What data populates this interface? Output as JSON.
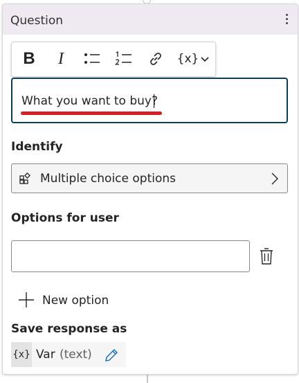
{
  "card": {
    "title": "Question",
    "more_icon": "more-vertical-icon"
  },
  "toolbar": {
    "bold_label": "B",
    "italic_label": "I",
    "buttons": [
      "bold-icon",
      "italic-icon",
      "bulleted-list-icon",
      "numbered-list-icon",
      "link-icon",
      "insert-variable-icon"
    ],
    "variable_label": "{x}"
  },
  "question": {
    "value": "What you want to buy?",
    "highlight_color": "#d42026",
    "border_color": "#0b3d56"
  },
  "identify": {
    "label": "Identify",
    "value": "Multiple choice options",
    "icon": "multiple-choice-icon"
  },
  "options": {
    "label": "Options for user",
    "input_value": "",
    "delete_icon": "trash-icon",
    "new_option_label": "New option"
  },
  "save_response": {
    "label": "Save response as",
    "var_badge": "{x}",
    "var_name": "Var",
    "var_type": "(text)",
    "edit_icon": "pencil-icon"
  }
}
